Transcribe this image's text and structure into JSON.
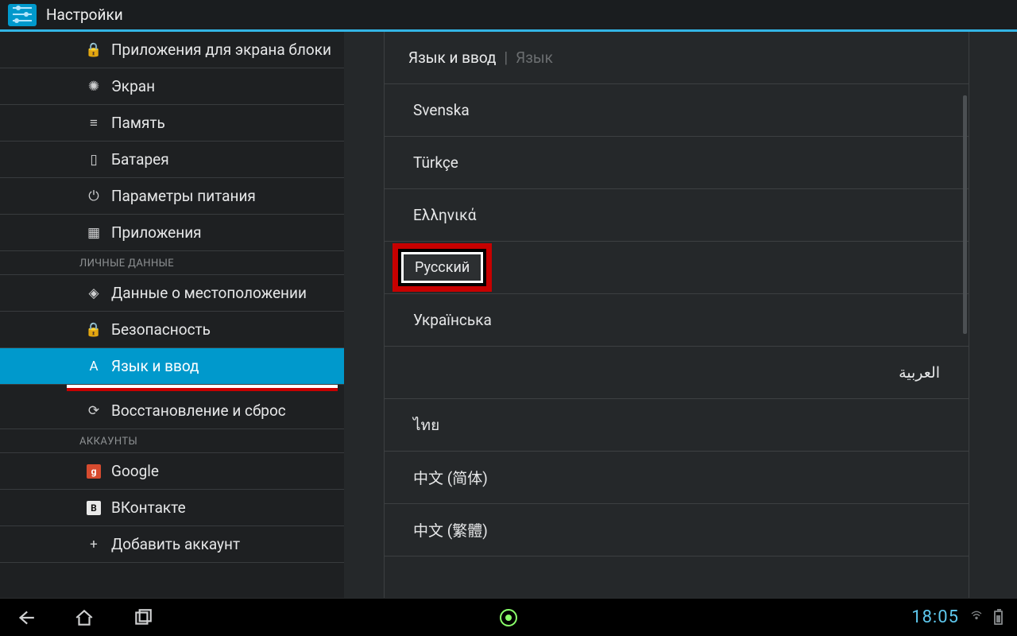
{
  "appbar": {
    "title": "Настройки"
  },
  "sidebar": {
    "items_top": [
      {
        "key": "lockapps",
        "icon": "🔒",
        "label": "Приложения для экрана блоки"
      },
      {
        "key": "display",
        "icon": "✺",
        "label": "Экран"
      },
      {
        "key": "storage",
        "icon": "≡",
        "label": "Память"
      },
      {
        "key": "battery",
        "icon": "▯",
        "label": "Батарея"
      },
      {
        "key": "power",
        "icon": "⏻",
        "label": "Параметры питания"
      },
      {
        "key": "apps",
        "icon": "▦",
        "label": "Приложения"
      }
    ],
    "section_personal": "ЛИЧНЫЕ ДАННЫЕ",
    "items_personal": [
      {
        "key": "location",
        "icon": "◈",
        "label": "Данные о местоположении"
      },
      {
        "key": "security",
        "icon": "🔒",
        "label": "Безопасность"
      },
      {
        "key": "language",
        "icon": "A",
        "label": "Язык и ввод",
        "active": true
      },
      {
        "key": "backup",
        "icon": "⟳",
        "label": "Восстановление и сброс"
      }
    ],
    "section_accounts": "АККАУНТЫ",
    "items_accounts": [
      {
        "key": "google",
        "label": "Google"
      },
      {
        "key": "vk",
        "label": "ВКонтакте"
      },
      {
        "key": "add",
        "icon": "+",
        "label": "Добавить аккаунт"
      }
    ]
  },
  "content": {
    "breadcrumb_current": "Язык и ввод",
    "breadcrumb_trail": "Язык",
    "languages": [
      {
        "label": "Svenska"
      },
      {
        "label": "Türkçe"
      },
      {
        "label": "Ελληνικά"
      },
      {
        "label": "Русский",
        "selected": true
      },
      {
        "label": "Українська"
      },
      {
        "label": "العربية",
        "rtl": true
      },
      {
        "label": "ไทย"
      },
      {
        "label": "中文 (简体)"
      },
      {
        "label": "中文 (繁體)"
      }
    ]
  },
  "navbar": {
    "clock": "18:05"
  }
}
